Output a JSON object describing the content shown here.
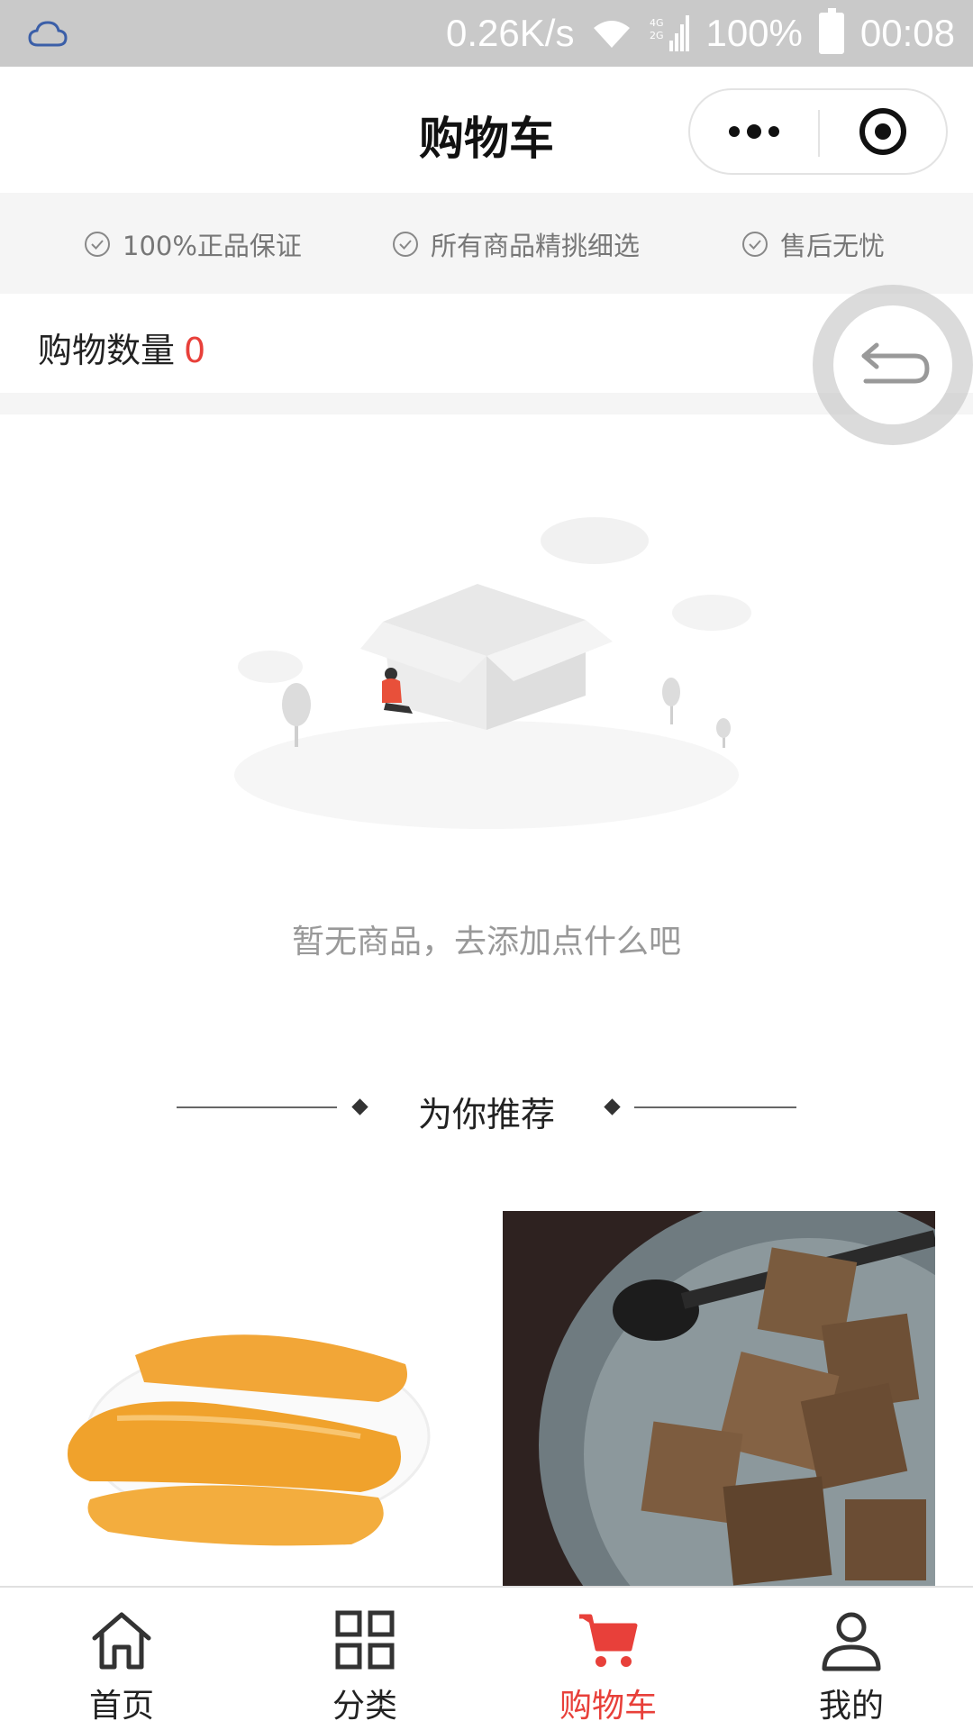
{
  "status_bar": {
    "net_speed": "0.26K/s",
    "battery": "100%",
    "time": "00:08"
  },
  "header": {
    "title": "购物车"
  },
  "guarantees": [
    {
      "label": "100%正品保证"
    },
    {
      "label": "所有商品精挑细选"
    },
    {
      "label": "售后无忧"
    }
  ],
  "cart": {
    "count_label": "购物数量",
    "count_value": "0"
  },
  "empty_state": {
    "message": "暂无商品，去添加点什么吧"
  },
  "recommend": {
    "title": "为你推荐"
  },
  "tabs": [
    {
      "label": "首页",
      "icon": "home-icon",
      "active": false
    },
    {
      "label": "分类",
      "icon": "grid-icon",
      "active": false
    },
    {
      "label": "购物车",
      "icon": "cart-icon",
      "active": true
    },
    {
      "label": "我的",
      "icon": "user-icon",
      "active": false
    }
  ],
  "colors": {
    "accent": "#e8403a",
    "status_bar": "#c9c9c9"
  }
}
